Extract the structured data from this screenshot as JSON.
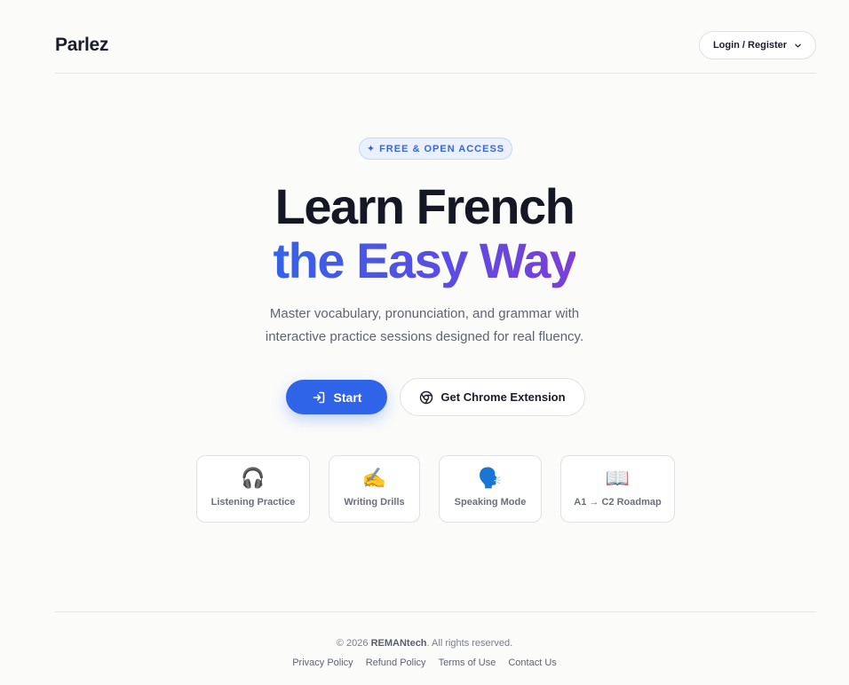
{
  "header": {
    "logo": "Parlez",
    "login_label": "Login / Register"
  },
  "hero": {
    "badge_icon": "✦",
    "badge_label": "FREE & OPEN ACCESS",
    "title_line1": "Learn French",
    "title_line2": "the Easy Way",
    "subtitle_line1": "Master vocabulary, pronunciation, and grammar with",
    "subtitle_line2": "interactive practice sessions designed for real fluency.",
    "start_label": "Start",
    "extension_label": "Get Chrome Extension"
  },
  "features": [
    {
      "emoji": "🎧",
      "label": "Listening Practice"
    },
    {
      "emoji": "✍️",
      "label": "Writing Drills"
    },
    {
      "emoji": "🗣️",
      "label": "Speaking Mode"
    },
    {
      "emoji": "📖",
      "label": "A1 → C2 Roadmap"
    }
  ],
  "footer": {
    "copyright_prefix": "© 2026",
    "company": "REMANtech",
    "copyright_suffix": ". All rights reserved.",
    "links": [
      "Privacy Policy",
      "Refund Policy",
      "Terms of Use",
      "Contact Us"
    ]
  },
  "colors": {
    "accent": "#2f63e8",
    "gradient_start": "#3562e6",
    "gradient_end": "#7b3fd8",
    "background": "#fbfbfa"
  },
  "icons": {
    "login_chevron": "chevron-down-icon",
    "start": "sign-in-icon",
    "extension": "chrome-icon"
  }
}
